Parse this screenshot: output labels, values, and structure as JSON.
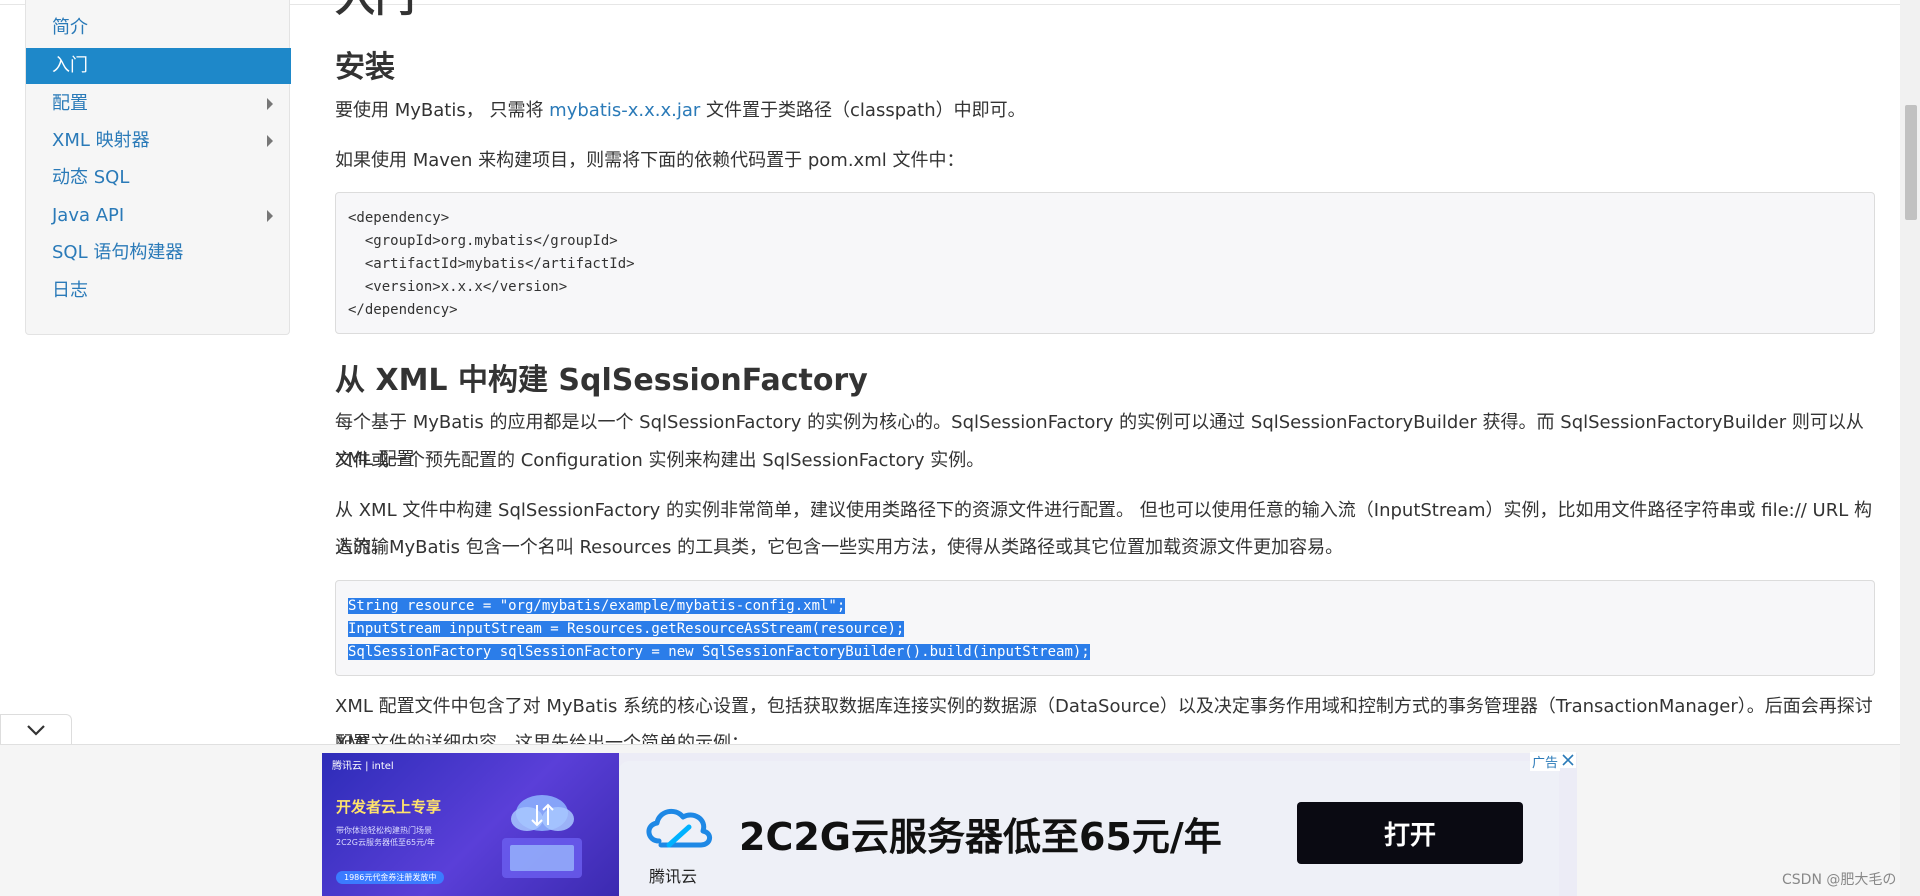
{
  "sidebar": {
    "items": [
      {
        "label": "简介",
        "has_children": false,
        "active": false
      },
      {
        "label": "入门",
        "has_children": false,
        "active": true
      },
      {
        "label": "配置",
        "has_children": true,
        "active": false
      },
      {
        "label": "XML 映射器",
        "has_children": true,
        "active": false
      },
      {
        "label": "动态 SQL",
        "has_children": false,
        "active": false
      },
      {
        "label": "Java API",
        "has_children": true,
        "active": false
      },
      {
        "label": "SQL 语句构建器",
        "has_children": false,
        "active": false
      },
      {
        "label": "日志",
        "has_children": false,
        "active": false
      }
    ]
  },
  "content": {
    "page_title_partial": "入门",
    "install_heading": "安装",
    "install_p1_before": "要使用 MyBatis， 只需将 ",
    "install_p1_link": "mybatis-x.x.x.jar",
    "install_p1_after": " 文件置于类路径（classpath）中即可。",
    "install_p2": "如果使用 Maven 来构建项目，则需将下面的依赖代码置于 pom.xml 文件中：",
    "maven_code": [
      "<dependency>",
      "  <groupId>org.mybatis</groupId>",
      "  <artifactId>mybatis</artifactId>",
      "  <version>x.x.x</version>",
      "</dependency>"
    ],
    "xml_heading": "从 XML 中构建 SqlSessionFactory",
    "xml_p1_line1": "每个基于 MyBatis 的应用都是以一个 SqlSessionFactory 的实例为核心的。SqlSessionFactory 的实例可以通过 SqlSessionFactoryBuilder 获得。而 SqlSessionFactoryBuilder 则可以从 XML 配置",
    "xml_p1_line2": "文件或一个预先配置的 Configuration 实例来构建出 SqlSessionFactory 实例。",
    "xml_p2_line1": "从 XML 文件中构建 SqlSessionFactory 的实例非常简单，建议使用类路径下的资源文件进行配置。 但也可以使用任意的输入流（InputStream）实例，比如用文件路径字符串或 file:// URL 构造的输",
    "xml_p2_line2": "入流。MyBatis 包含一个名叫 Resources 的工具类，它包含一些实用方法，使得从类路径或其它位置加载资源文件更加容易。",
    "java_code": [
      "String resource = \"org/mybatis/example/mybatis-config.xml\";",
      "InputStream inputStream = Resources.getResourceAsStream(resource);",
      "SqlSessionFactory sqlSessionFactory = new SqlSessionFactoryBuilder().build(inputStream);"
    ],
    "xml_p3_line1": "XML 配置文件中包含了对 MyBatis 系统的核心设置，包括获取数据库连接实例的数据源（DataSource）以及决定事务作用域和控制方式的事务管理器（TransactionManager）。后面会再探讨 XML",
    "xml_p3_line2": "配置文件的详细内容，这里先给出一个简单的示例："
  },
  "ad": {
    "brand": "腾讯云 | intel",
    "left_title": "开发者云上专享",
    "left_sub1": "带你体验轻松构建热门场景",
    "left_sub2": "2C2G云服务器低至65元/年",
    "left_tag": "1986元代金券注册发放中",
    "logo_text": "腾讯云",
    "headline": "2C2G云服务器低至65元/年",
    "button": "打开",
    "label": "广告"
  },
  "watermark": "CSDN @肥大毛の",
  "colors": {
    "link": "#2a7ab8",
    "active_nav": "#1e88c9",
    "selection": "#2b7de9"
  }
}
